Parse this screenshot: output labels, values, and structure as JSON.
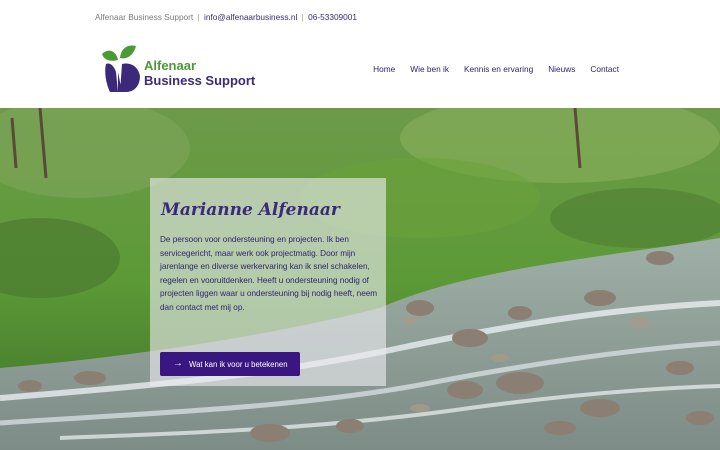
{
  "topbar": {
    "company": "Alfenaar Business Support",
    "email": "info@alfenaarbusiness.nl",
    "phone": "06-53309001",
    "separator": "|"
  },
  "logo": {
    "line1": "Alfenaar",
    "line2": "Business Support",
    "colors": {
      "green": "#4a9a35",
      "purple": "#3b2a7a"
    }
  },
  "nav": {
    "items": [
      {
        "label": "Home"
      },
      {
        "label": "Wie ben ik"
      },
      {
        "label": "Kennis en ervaring"
      },
      {
        "label": "Nieuws"
      },
      {
        "label": "Contact"
      }
    ]
  },
  "hero": {
    "title": "Marianne Alfenaar",
    "body": "De persoon voor ondersteuning en projecten. Ik ben servicegericht, maar werk ook projectmatig. Door mijn jarenlange en diverse werkervaring kan ik snel schakelen, regelen en vooruitdenken. Heeft u ondersteuning nodig of projecten liggen waar u ondersteuning bij nodig heeft, neem dan contact met mij op.",
    "cta_label": "Wat kan ik voor u betekenen",
    "cta_icon": "arrow-right-icon",
    "background": "mountain-stream-landscape",
    "colors": {
      "accent": "#3a1680",
      "text": "#2e2370"
    }
  }
}
